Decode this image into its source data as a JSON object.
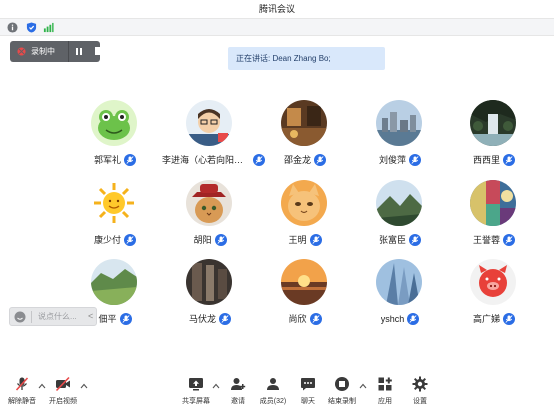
{
  "window": {
    "title": "腾讯会议"
  },
  "recording": {
    "label": "录制中"
  },
  "banner": {
    "text": "正在讲话: Dean Zhang Bo;"
  },
  "participants": [
    {
      "name": "郭军礼",
      "avatar": "frog-avatar"
    },
    {
      "name": "李进海（心若向阳，...",
      "avatar": "cartoon-avatar"
    },
    {
      "name": "邵金龙",
      "avatar": "interior-avatar"
    },
    {
      "name": "刘俊萍",
      "avatar": "city-avatar"
    },
    {
      "name": "西西里",
      "avatar": "waterfall-avatar"
    },
    {
      "name": "康少付",
      "avatar": "sun-avatar"
    },
    {
      "name": "胡阳",
      "avatar": "cat-hat-avatar"
    },
    {
      "name": "王明",
      "avatar": "cat-avatar"
    },
    {
      "name": "张富臣",
      "avatar": "mountain-avatar"
    },
    {
      "name": "王誉蓉",
      "avatar": "painting-avatar"
    },
    {
      "name": "佃平",
      "avatar": "field-avatar"
    },
    {
      "name": "马伏龙",
      "avatar": "dark-avatar"
    },
    {
      "name": "尚欣",
      "avatar": "sunset-avatar"
    },
    {
      "name": "yshch",
      "avatar": "skyscraper-avatar"
    },
    {
      "name": "高广娣",
      "avatar": "pig-avatar"
    }
  ],
  "chat": {
    "placeholder": "说点什么...",
    "collapse": "<"
  },
  "toolbar": {
    "unmute": "解除静音",
    "video": "开启视频",
    "share": "共享屏幕",
    "invite": "邀请",
    "members": "成员(32)",
    "chat": "聊天",
    "stop_record": "结束录制",
    "apps": "应用",
    "settings": "设置"
  },
  "colors": {
    "accent": "#2b6de5",
    "recording": "#e84a4a"
  }
}
